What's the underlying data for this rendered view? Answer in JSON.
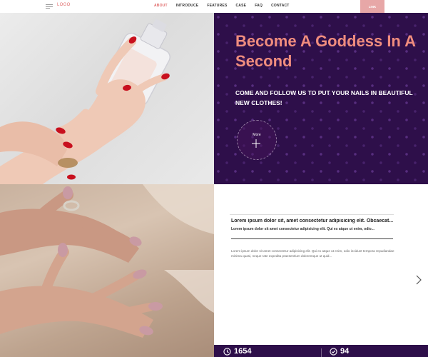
{
  "nav": {
    "logo": "LOGO",
    "links": [
      "ABOUT",
      "INTRODUCE",
      "FEATURES",
      "CASE",
      "FAQ",
      "CONTACT"
    ],
    "active_link": "ABOUT",
    "link_button": "LINK"
  },
  "hero": {
    "title": "Become A Goddess In A Second",
    "subtitle": "COME AND FOLLOW US TO PUT YOUR NAILS IN BEAUTIFUL NEW CLOTHES!",
    "more_label": "More"
  },
  "article": {
    "title": "Lorem ipsum dolor sit, amet consectetur adipisicing elit. Obcaecat...",
    "subtitle": "Lorem ipsum dolor sit amet consectetur adipisicing elit. Qui ex atque ut enim, odio...",
    "body": "Lorem ipsum dolor sit amet consectetur adipisicing elit. Qui ex atque ut enim, odio incidunt tempora repudiandae minima quasi, neque rate expedita praesentium doloremque ut quid..."
  },
  "stats": [
    {
      "icon": "clock-icon",
      "value": "1654"
    },
    {
      "icon": "check-circle-icon",
      "value": "94"
    }
  ],
  "colors": {
    "accent": "#e06a6a",
    "hero_title": "#f08d7e",
    "purple": "#2e0f4a",
    "link_button": "#e7a7a7"
  }
}
